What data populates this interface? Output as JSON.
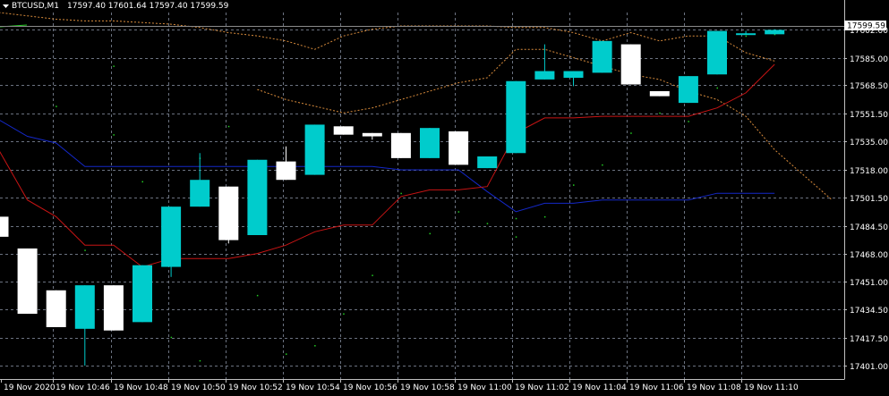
{
  "header": {
    "symbol": "BTCUSD,M1",
    "ohlc": "17597.40 17601.64 17597.40 17599.59",
    "dropdown_icon": "triangle-down-icon"
  },
  "colors": {
    "background": "#000000",
    "grid": "#6b7280",
    "axis": "#c0c0c0",
    "bull": "#00cccc",
    "bear": "#ffffff",
    "ma_blue": "#1428c8",
    "ma_red": "#c81414",
    "envelope": "#d98c3c",
    "dots": "#22cc22",
    "current_price_label_bg": "#ffffff"
  },
  "chart_data": {
    "type": "candlestick",
    "title": "",
    "ylim": [
      17393,
      17612
    ],
    "y_ticks": [
      "17602.00",
      "17585.00",
      "17568.50",
      "17551.50",
      "17535.00",
      "17518.00",
      "17501.50",
      "17484.50",
      "17468.00",
      "17451.00",
      "17434.50",
      "17417.50",
      "17401.00"
    ],
    "x_ticks": [
      "19 Nov 2020",
      "19 Nov 10:46",
      "19 Nov 10:48",
      "19 Nov 10:50",
      "19 Nov 10:52",
      "19 Nov 10:54",
      "19 Nov 10:56",
      "19 Nov 10:58",
      "19 Nov 11:00",
      "19 Nov 11:02",
      "19 Nov 11:04",
      "19 Nov 11:06",
      "19 Nov 11:08",
      "19 Nov 11:10"
    ],
    "current_price": "17599.59",
    "candles": [
      {
        "o": 17490,
        "h": 17494,
        "l": 17475,
        "c": 17478
      },
      {
        "o": 17471,
        "h": 17471,
        "l": 17432,
        "c": 17432
      },
      {
        "o": 17446,
        "h": 17446,
        "l": 17424,
        "c": 17424
      },
      {
        "o": 17423,
        "h": 17449,
        "l": 17401,
        "c": 17449
      },
      {
        "o": 17449,
        "h": 17449,
        "l": 17422,
        "c": 17422
      },
      {
        "o": 17427,
        "h": 17461,
        "l": 17427,
        "c": 17461
      },
      {
        "o": 17460,
        "h": 17496,
        "l": 17454,
        "c": 17496
      },
      {
        "o": 17496,
        "h": 17528,
        "l": 17496,
        "c": 17512
      },
      {
        "o": 17508,
        "h": 17508,
        "l": 17474,
        "c": 17476
      },
      {
        "o": 17479,
        "h": 17524,
        "l": 17479,
        "c": 17524
      },
      {
        "o": 17523,
        "h": 17532,
        "l": 17512,
        "c": 17512
      },
      {
        "o": 17515,
        "h": 17545,
        "l": 17515,
        "c": 17545
      },
      {
        "o": 17544,
        "h": 17544,
        "l": 17539,
        "c": 17539
      },
      {
        "o": 17540,
        "h": 17540,
        "l": 17536,
        "c": 17538
      },
      {
        "o": 17540,
        "h": 17540,
        "l": 17525,
        "c": 17525
      },
      {
        "o": 17525,
        "h": 17543,
        "l": 17525,
        "c": 17543
      },
      {
        "o": 17541,
        "h": 17541,
        "l": 17521,
        "c": 17521
      },
      {
        "o": 17519,
        "h": 17526,
        "l": 17519,
        "c": 17526
      },
      {
        "o": 17528,
        "h": 17571,
        "l": 17528,
        "c": 17571
      },
      {
        "o": 17572,
        "h": 17593,
        "l": 17572,
        "c": 17577
      },
      {
        "o": 17573,
        "h": 17577,
        "l": 17568,
        "c": 17577
      },
      {
        "o": 17576,
        "h": 17595,
        "l": 17576,
        "c": 17595
      },
      {
        "o": 17593,
        "h": 17593,
        "l": 17569,
        "c": 17569
      },
      {
        "o": 17565,
        "h": 17565,
        "l": 17562,
        "c": 17562
      },
      {
        "o": 17558,
        "h": 17574,
        "l": 17558,
        "c": 17574
      },
      {
        "o": 17575,
        "h": 17601,
        "l": 17575,
        "c": 17601
      },
      {
        "o": 17599,
        "h": 17601,
        "l": 17599,
        "c": 17599.6
      },
      {
        "o": 17599,
        "h": 17602,
        "l": 17599,
        "c": 17601.6
      }
    ],
    "ma_blue": [
      17548,
      17538,
      17534,
      17520,
      17520,
      17520,
      17520,
      17520,
      17520,
      17520,
      17520,
      17520,
      17520,
      17520,
      17518,
      17518,
      17518,
      17505,
      17493,
      17498,
      17498,
      17500,
      17500,
      17500,
      17500,
      17504,
      17504,
      17504
    ],
    "ma_red": [
      17530,
      17500,
      17490,
      17473,
      17473,
      17460,
      17465,
      17465,
      17465,
      17468,
      17473,
      17481,
      17485,
      17485,
      17502,
      17506,
      17506,
      17508,
      17540,
      17549,
      17549,
      17550,
      17550,
      17550,
      17550,
      17555,
      17564,
      17581
    ],
    "envelope_upper": [
      17612,
      17610,
      17608,
      17607,
      17607,
      17606,
      17605,
      17603,
      17600,
      17598,
      17595,
      17590,
      17598,
      17602,
      17604,
      17604,
      17604,
      17604,
      17603,
      17603,
      17600,
      17595,
      17600,
      17595,
      17598,
      17598,
      17588,
      17583
    ],
    "envelope_lower": [
      17566,
      17560,
      17556,
      17552,
      17555,
      17560,
      17565,
      17570,
      17573,
      17590,
      17590,
      17585,
      17580,
      17575,
      17572,
      17565,
      17560,
      17550,
      17530,
      17515,
      17500
    ],
    "dots": [
      [
        2,
        17556
      ],
      [
        3,
        17428
      ],
      [
        3,
        17470
      ],
      [
        4,
        17443
      ],
      [
        4,
        17580
      ],
      [
        4,
        17539
      ],
      [
        5,
        17511
      ],
      [
        6,
        17463
      ],
      [
        6,
        17418
      ],
      [
        7,
        17404
      ],
      [
        7,
        17525
      ],
      [
        8,
        17544
      ],
      [
        9,
        17443
      ],
      [
        10,
        17408
      ],
      [
        11,
        17413
      ],
      [
        12,
        17432
      ],
      [
        13,
        17455
      ],
      [
        14,
        17504
      ],
      [
        15,
        17480
      ],
      [
        16,
        17493
      ],
      [
        17,
        17486
      ],
      [
        18,
        17478
      ],
      [
        18,
        17489
      ],
      [
        19,
        17490
      ],
      [
        20,
        17509
      ],
      [
        21,
        17521
      ],
      [
        22,
        17540
      ],
      [
        23,
        17552
      ],
      [
        24,
        17547
      ],
      [
        25,
        17567
      ],
      [
        26,
        17598
      ],
      [
        27,
        17599
      ]
    ]
  }
}
